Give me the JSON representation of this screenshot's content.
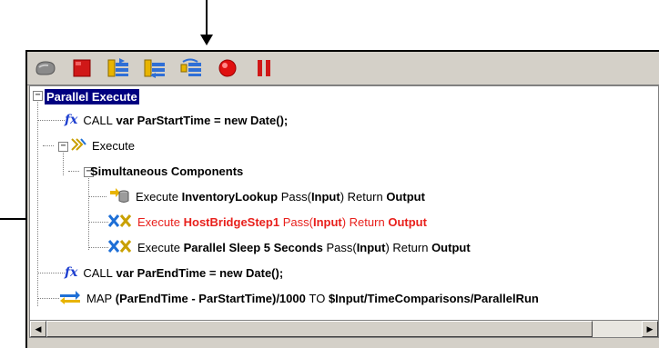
{
  "toolbar": {
    "buttons": [
      {
        "name": "go-icon",
        "color": "#7a7a7a"
      },
      {
        "name": "stop-icon",
        "color": "#d01818"
      },
      {
        "name": "step-into-icon",
        "color": "#2f6fd6"
      },
      {
        "name": "step-out-icon",
        "color": "#2f6fd6"
      },
      {
        "name": "step-over-icon",
        "color": "#2f6fd6"
      },
      {
        "name": "breakpoint-icon",
        "color": "#e01010"
      },
      {
        "name": "pause-icon",
        "color": "#d01818"
      }
    ]
  },
  "tree": {
    "root": "Parallel Execute",
    "call1": {
      "prefix": "CALL",
      "code": "var ParStartTime = new Date();"
    },
    "execute": "Execute",
    "simultaneous": "Simultaneous Components",
    "item1": {
      "exec": "Execute",
      "name": "InventoryLookup",
      "pass": "Pass",
      "input": "Input",
      "ret": "Return",
      "output": "Output"
    },
    "item2": {
      "exec": "Execute",
      "name": "HostBridgeStep1",
      "pass": "Pass",
      "input": "Input",
      "ret": "Return",
      "output": "Output"
    },
    "item3": {
      "exec": "Execute",
      "name": "Parallel Sleep 5 Seconds",
      "pass": "Pass",
      "input": "Input",
      "ret": "Return",
      "output": "Output"
    },
    "call2": {
      "prefix": "CALL",
      "code": "var ParEndTime = new Date();"
    },
    "map": {
      "prefix": "MAP",
      "expr": "(ParEndTime - ParStartTime)/1000",
      "to": "TO",
      "target": "$Input/TimeComparisons/ParallelRun"
    }
  }
}
